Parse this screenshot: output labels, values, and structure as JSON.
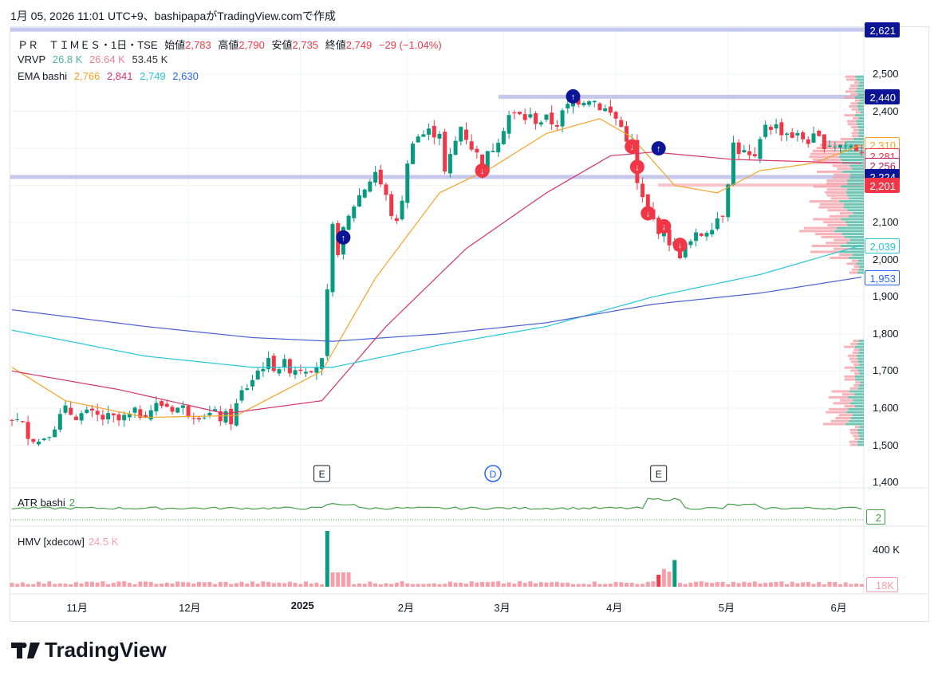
{
  "credit": "1月 05, 2026 11:01 UTC+9、bashipapaがTradingView.comで作成",
  "legend": {
    "symbol": "ＰＲ　ＴＩＭＥＳ・1日・TSE",
    "open_label": "始値",
    "open": "2,783",
    "high_label": "高値",
    "high": "2,790",
    "low_label": "安値",
    "low": "2,735",
    "close_label": "終値",
    "close": "2,749",
    "change": "−29 (−1.04%)",
    "vrvp_label": "VRVP",
    "vrvp": [
      "26.8 K",
      "26.64 K",
      "53.45 K"
    ],
    "ema_label": "EMA bashi",
    "ema": [
      "2,766",
      "2,841",
      "2,749",
      "2,630"
    ]
  },
  "atr": {
    "label": "ATR bashi",
    "value": "2",
    "axis_label": "2"
  },
  "hmv": {
    "label": "HMV [xdecow]",
    "value": "24.5 K",
    "tick": "400 K",
    "axis_label": "18K"
  },
  "price_ticks": [
    "2,500",
    "2,400",
    "2,300",
    "2,200",
    "2,100",
    "2,000",
    "1,900",
    "1,800",
    "1,700",
    "1,600",
    "1,500",
    "1,400"
  ],
  "price_labels": [
    {
      "text": "2,621",
      "price": 2621,
      "bg": "#0c1596",
      "fg": "#ffffff",
      "border": "#0c1596"
    },
    {
      "text": "2,440",
      "price": 2440,
      "bg": "#0c1596",
      "fg": "#ffffff",
      "border": "#0c1596"
    },
    {
      "text": "2,310",
      "price": 2310,
      "bg": "#ffffff",
      "fg": "#f7a325",
      "border": "#f7a325"
    },
    {
      "text": "2,281",
      "price": 2281,
      "bg": "#ffffff",
      "fg": "#f23645",
      "border": "#f23645"
    },
    {
      "text": "2,256",
      "price": 2256,
      "bg": "#ffffff",
      "fg": "#c2185b",
      "border": "#c2185b"
    },
    {
      "text": "2,224",
      "price": 2224,
      "bg": "#0c1596",
      "fg": "#ffffff",
      "border": "#0c1596"
    },
    {
      "text": "2,201",
      "price": 2201,
      "bg": "#f23645",
      "fg": "#ffffff",
      "border": "#f23645"
    },
    {
      "text": "2,039",
      "price": 2039,
      "bg": "#ffffff",
      "fg": "#26c6da",
      "border": "#26c6da"
    },
    {
      "text": "1,953",
      "price": 1953,
      "bg": "#ffffff",
      "fg": "#2962ff",
      "border": "#2962ff"
    }
  ],
  "x_ticks": [
    {
      "text": "11月",
      "day": 12
    },
    {
      "text": "12月",
      "day": 33
    },
    {
      "text": "2025",
      "day": 54,
      "bold": true
    },
    {
      "text": "2月",
      "day": 74
    },
    {
      "text": "3月",
      "day": 92
    },
    {
      "text": "4月",
      "day": 113
    },
    {
      "text": "5月",
      "day": 134
    },
    {
      "text": "6月",
      "day": 155
    }
  ],
  "events": [
    {
      "text": "E",
      "day": 58
    },
    {
      "text": "D",
      "day": 90,
      "dividend": true
    },
    {
      "text": "E",
      "day": 121
    }
  ],
  "levels": [
    2621,
    2440,
    2224
  ],
  "colors": {
    "up": "#089981",
    "down": "#f23645",
    "ema1": "#f7a325",
    "ema2": "#d6336c",
    "ema3": "#26c6da",
    "ema4": "#4a5fd6"
  },
  "chart_data": {
    "type": "candlestick",
    "ylim": [
      1400,
      2650
    ],
    "close_path": [
      [
        0,
        1575
      ],
      [
        5,
        1510
      ],
      [
        10,
        1590
      ],
      [
        20,
        1565
      ],
      [
        28,
        1610
      ],
      [
        41,
        1570
      ],
      [
        43,
        1640
      ],
      [
        47,
        1720
      ],
      [
        53,
        1710
      ],
      [
        58,
        1720
      ],
      [
        60,
        2080
      ],
      [
        61,
        2030
      ],
      [
        64,
        2150
      ],
      [
        68,
        2240
      ],
      [
        72,
        2090
      ],
      [
        75,
        2330
      ],
      [
        80,
        2350
      ],
      [
        81,
        2230
      ],
      [
        84,
        2360
      ],
      [
        87,
        2280
      ],
      [
        88,
        2250
      ],
      [
        93,
        2390
      ],
      [
        102,
        2370
      ],
      [
        105,
        2430
      ],
      [
        108,
        2440
      ],
      [
        113,
        2380
      ],
      [
        116,
        2310
      ],
      [
        117,
        2200
      ],
      [
        119,
        2120
      ],
      [
        122,
        2070
      ],
      [
        125,
        2020
      ],
      [
        129,
        2070
      ],
      [
        133,
        2130
      ],
      [
        135,
        2310
      ],
      [
        139,
        2260
      ],
      [
        141,
        2370
      ],
      [
        147,
        2330
      ],
      [
        159,
        2300
      ]
    ],
    "ema_fast": [
      [
        0,
        1710
      ],
      [
        10,
        1620
      ],
      [
        25,
        1575
      ],
      [
        42,
        1580
      ],
      [
        58,
        1700
      ],
      [
        68,
        1950
      ],
      [
        80,
        2180
      ],
      [
        90,
        2250
      ],
      [
        100,
        2340
      ],
      [
        110,
        2380
      ],
      [
        116,
        2330
      ],
      [
        124,
        2200
      ],
      [
        132,
        2180
      ],
      [
        140,
        2240
      ],
      [
        150,
        2260
      ],
      [
        159,
        2310
      ]
    ],
    "ema_mid": [
      [
        0,
        1700
      ],
      [
        20,
        1650
      ],
      [
        40,
        1585
      ],
      [
        58,
        1620
      ],
      [
        70,
        1820
      ],
      [
        85,
        2030
      ],
      [
        100,
        2180
      ],
      [
        112,
        2280
      ],
      [
        120,
        2290
      ],
      [
        135,
        2270
      ],
      [
        159,
        2260
      ]
    ],
    "ema_slow": [
      [
        0,
        1810
      ],
      [
        25,
        1740
      ],
      [
        45,
        1710
      ],
      [
        60,
        1710
      ],
      [
        80,
        1770
      ],
      [
        100,
        1820
      ],
      [
        120,
        1900
      ],
      [
        140,
        1960
      ],
      [
        159,
        2039
      ]
    ],
    "ema_long": [
      [
        0,
        1865
      ],
      [
        25,
        1820
      ],
      [
        45,
        1790
      ],
      [
        60,
        1780
      ],
      [
        80,
        1800
      ],
      [
        100,
        1830
      ],
      [
        120,
        1880
      ],
      [
        140,
        1910
      ],
      [
        159,
        1953
      ]
    ]
  }
}
